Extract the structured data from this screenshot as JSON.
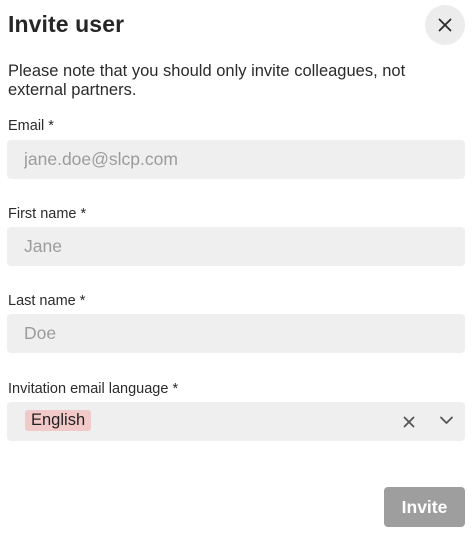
{
  "dialog": {
    "title": "Invite user",
    "note": "Please note that you should only invite colleagues, not external partners."
  },
  "form": {
    "email": {
      "label": "Email *",
      "placeholder": "jane.doe@slcp.com",
      "value": ""
    },
    "first_name": {
      "label": "First name *",
      "placeholder": "Jane",
      "value": ""
    },
    "last_name": {
      "label": "Last name *",
      "placeholder": "Doe",
      "value": ""
    },
    "language": {
      "label": "Invitation email language *",
      "selected": "English"
    }
  },
  "actions": {
    "invite_label": "Invite"
  },
  "icons": {
    "close": "close-icon",
    "clear": "clear-icon",
    "dropdown": "chevron-down-icon"
  },
  "colors": {
    "tag_bg": "#f2c9c9",
    "button_bg": "#9e9e9e",
    "field_bg": "#efefef"
  }
}
